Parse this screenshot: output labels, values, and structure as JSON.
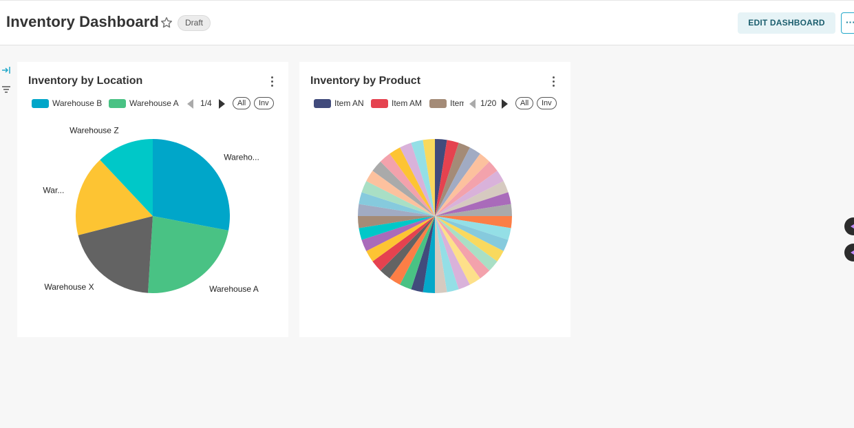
{
  "header": {
    "title": "Inventory Dashboard",
    "status_badge": "Draft",
    "edit_button": "EDIT DASHBOARD",
    "more_button": "···"
  },
  "colors": {
    "accent": "#20a7c9",
    "edit_button_bg": "#e6f3f6",
    "edit_button_text": "#1a5d6d"
  },
  "icons": {
    "favorite": "star-outline-icon",
    "collapse_sidebar": "expand-arrow-icon",
    "filter": "filter-icon",
    "card_menu": "kebab-menu-icon",
    "legend_prev": "triangle-left-icon",
    "legend_next": "triangle-right-icon"
  },
  "cards": [
    {
      "title": "Inventory by Location",
      "legend": {
        "items": [
          {
            "label": "Warehouse B",
            "color": "#00a6c9"
          },
          {
            "label": "Warehouse A",
            "color": "#49c284"
          }
        ],
        "page": "1/4",
        "all_label": "All",
        "inv_label": "Inv"
      },
      "chart_data": {
        "type": "pie",
        "slices": [
          {
            "label": "Wareho...",
            "value": 28,
            "color": "#00a6c9"
          },
          {
            "label": "Warehouse A",
            "value": 23,
            "color": "#49c284"
          },
          {
            "label": "Warehouse X",
            "value": 20,
            "color": "#636363"
          },
          {
            "label": "War...",
            "value": 17,
            "color": "#fdc433"
          },
          {
            "label": "Warehouse Z",
            "value": 12,
            "color": "#00c8c8"
          }
        ]
      }
    },
    {
      "title": "Inventory by Product",
      "legend": {
        "items": [
          {
            "label": "Item AN",
            "color": "#414b7c"
          },
          {
            "label": "Item AM",
            "color": "#e5424f"
          },
          {
            "label": "Item",
            "color": "#a48b77"
          }
        ],
        "page": "1/20",
        "all_label": "All",
        "inv_label": "Inv"
      },
      "chart_data": {
        "type": "pie",
        "slice_count": 40,
        "colors": [
          "#414b7c",
          "#e5424f",
          "#a48b77",
          "#a1abc3",
          "#fcc19e",
          "#f3a2ac",
          "#d9b2da",
          "#d6cac0",
          "#a96bba",
          "#aaaaaa",
          "#fc7e46",
          "#94dfe6",
          "#86cadd",
          "#f9d95e",
          "#a9dfc5",
          "#f3a2ac",
          "#fde08a",
          "#d9b2da",
          "#94dfe6",
          "#d6cac0",
          "#05a8c9",
          "#414b7c",
          "#49c284",
          "#fc7e46",
          "#636363",
          "#e5424f",
          "#fdc433",
          "#a96bba",
          "#00c8c8",
          "#a48b77",
          "#a1abc3",
          "#86cadd",
          "#a9dfc5",
          "#fcc19e",
          "#aaaaaa",
          "#f3a2ac",
          "#fdc433",
          "#d9b2da",
          "#94dfe6",
          "#f9d95e"
        ]
      }
    }
  ]
}
